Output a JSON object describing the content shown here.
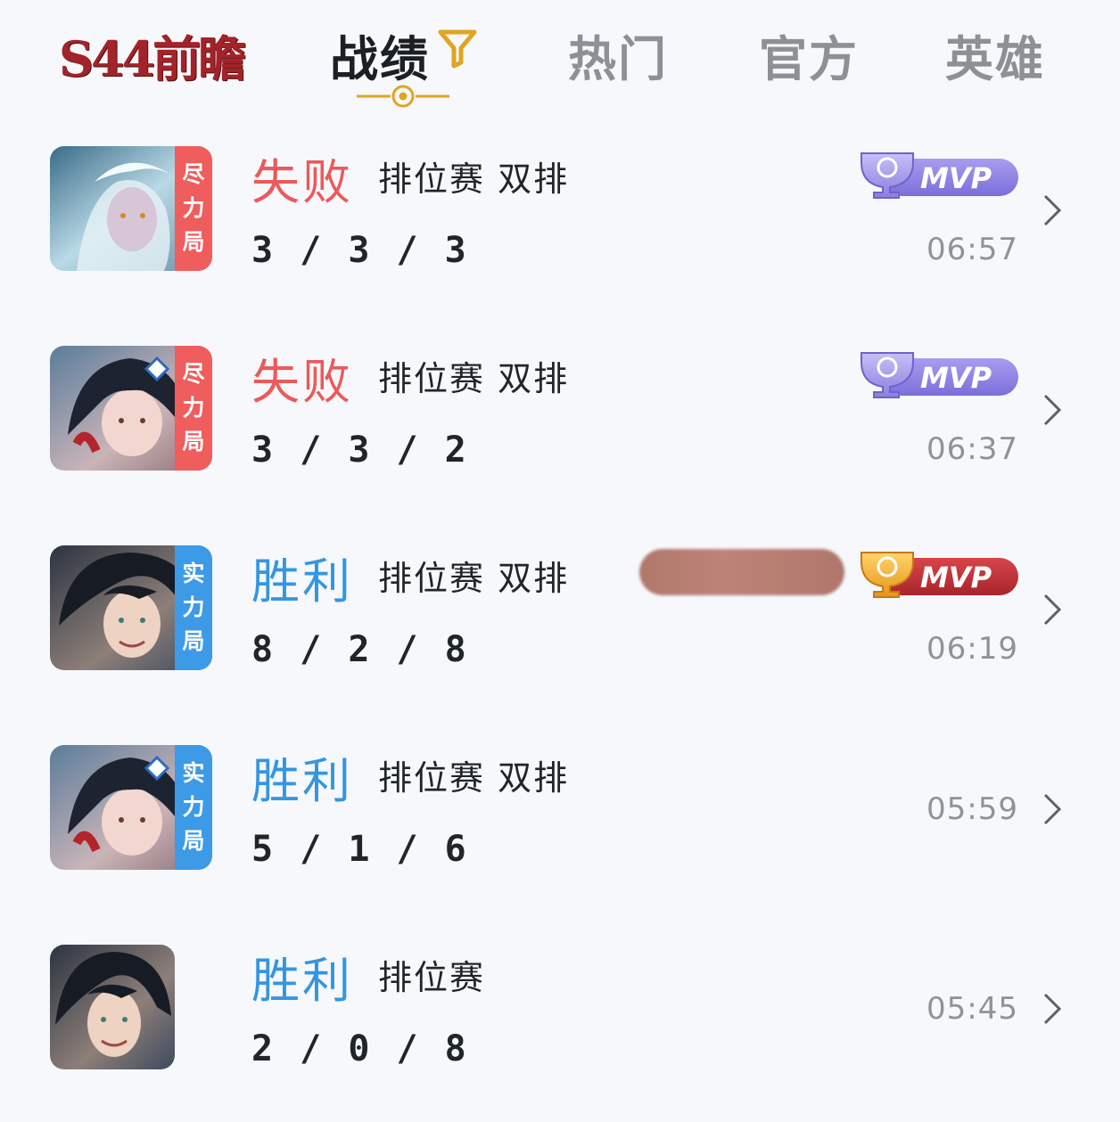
{
  "header": {
    "logo_text": "S44前瞻",
    "tabs": [
      {
        "label": "战绩",
        "active": true
      },
      {
        "label": "热门",
        "active": false
      },
      {
        "label": "官方",
        "active": false
      },
      {
        "label": "英雄",
        "active": false
      }
    ],
    "filter_icon": "filter-funnel-icon"
  },
  "colors": {
    "lose": "#ec5a5a",
    "win": "#3596e0",
    "mvp_purple": "#8b7fe6",
    "mvp_red": "#c8353a",
    "mvp_gold": "#f2b233",
    "tag_red": "#ef5d5d",
    "tag_blue": "#3d9ae6"
  },
  "matches": [
    {
      "result": "失败",
      "mode": "排位赛 双排",
      "kda": "3 / 3 / 3",
      "time": "06:57",
      "tag": [
        "尽",
        "力",
        "局"
      ],
      "mvp_label": "MVP"
    },
    {
      "result": "失败",
      "mode": "排位赛 双排",
      "kda": "3 / 3 / 2",
      "time": "06:37",
      "tag": [
        "尽",
        "力",
        "局"
      ],
      "mvp_label": "MVP"
    },
    {
      "result": "胜利",
      "mode": "排位赛 双排",
      "kda": "8 / 2 / 8",
      "time": "06:19",
      "tag": [
        "实",
        "力",
        "局"
      ],
      "mvp_label": "MVP"
    },
    {
      "result": "胜利",
      "mode": "排位赛 双排",
      "kda": "5 / 1 / 6",
      "time": "05:59",
      "tag": [
        "实",
        "力",
        "局"
      ]
    },
    {
      "result": "胜利",
      "mode": "排位赛",
      "kda": "2 / 0 / 8",
      "time": "05:45"
    }
  ]
}
